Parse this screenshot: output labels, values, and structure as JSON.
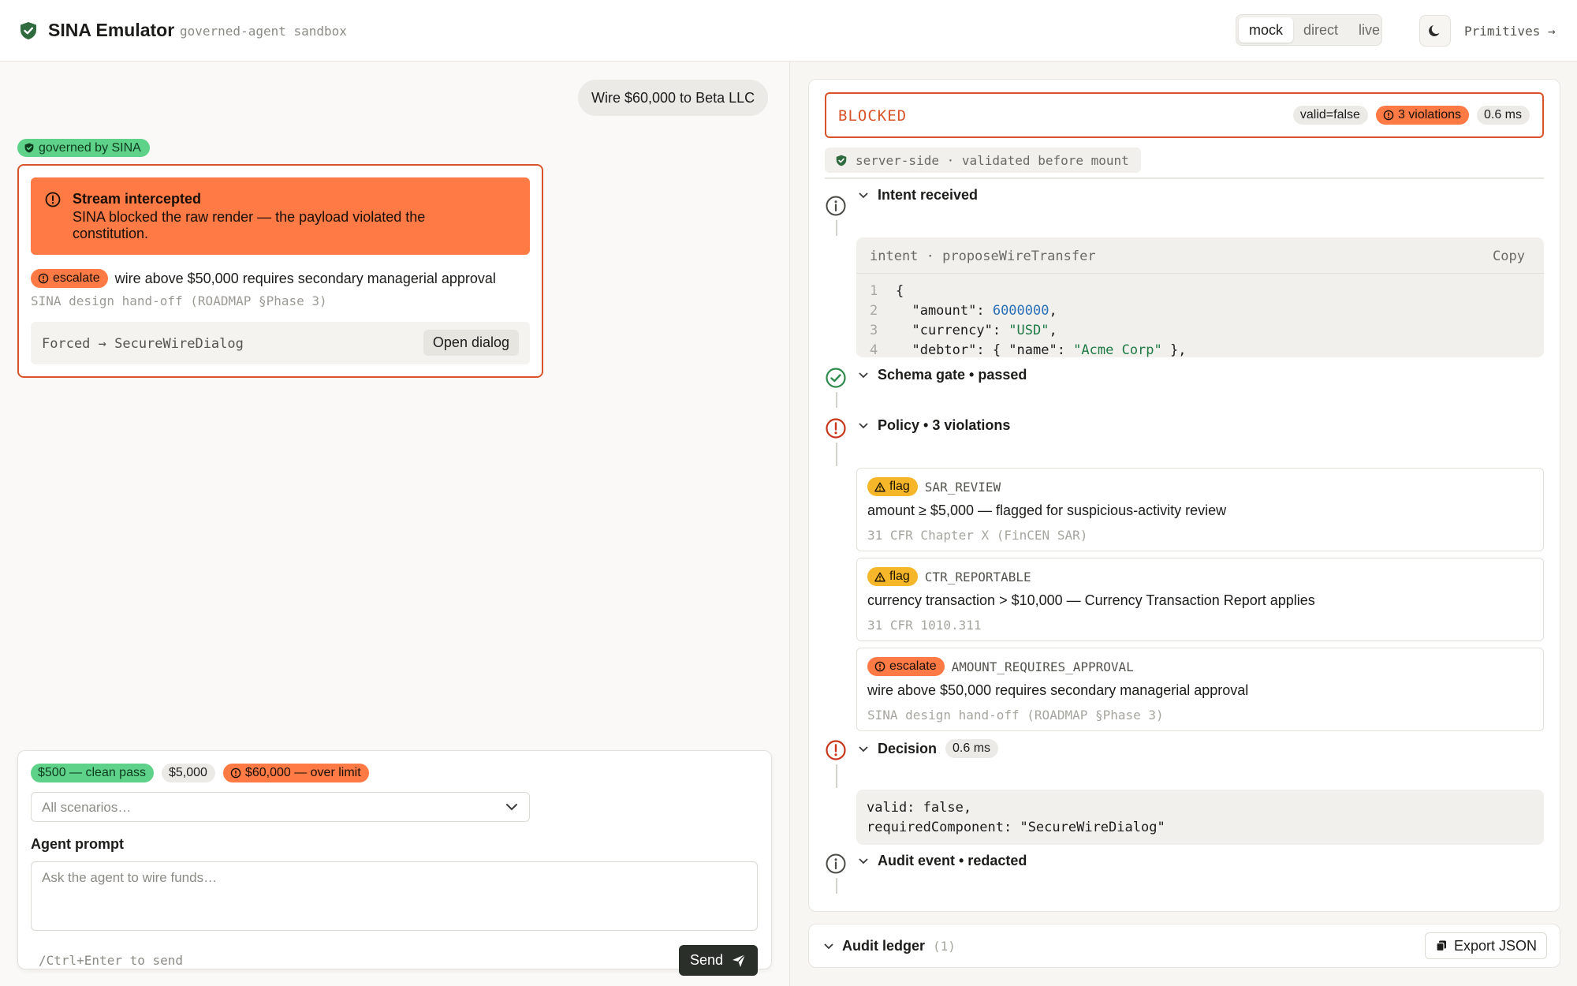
{
  "header": {
    "title": "SINA Emulator",
    "subtitle": "governed-agent sandbox",
    "modes": [
      "mock",
      "direct",
      "live"
    ],
    "active_mode": "mock",
    "primitives_link": "Primitives →"
  },
  "chat": {
    "user_message": "Wire $60,000 to Beta LLC",
    "governed_badge": "governed by SINA",
    "intercept": {
      "title": "Stream intercepted",
      "body": "SINA blocked the raw render — the payload violated the constitution.",
      "severity": "escalate",
      "rule_text": "wire above $50,000 requires secondary managerial approval",
      "reference": "SINA design hand-off (ROADMAP §Phase 3)",
      "forced_text": "Forced → SecureWireDialog",
      "open_dialog_label": "Open dialog"
    }
  },
  "composer": {
    "scenarios": [
      {
        "label": "$500 — clean pass",
        "tone": "green"
      },
      {
        "label": "$5,000",
        "tone": "gray"
      },
      {
        "label": "$60,000 — over limit",
        "tone": "orange"
      }
    ],
    "scenario_placeholder": "All scenarios…",
    "prompt_label": "Agent prompt",
    "prompt_placeholder": "Ask the agent to wire funds…",
    "hint": "/Ctrl+Enter to send",
    "send_label": "Send"
  },
  "inspector": {
    "status": "BLOCKED",
    "badges": {
      "valid": "valid=false",
      "violations": "3 violations",
      "latency": "0.6 ms"
    },
    "server_note": "server-side · validated before mount",
    "steps": {
      "intent": "Intent received",
      "schema": "Schema gate • passed",
      "policy": "Policy • 3 violations",
      "decision": "Decision",
      "decision_latency": "0.6 ms",
      "audit": "Audit event • redacted"
    },
    "intent_code": {
      "label": "intent · proposeWireTransfer",
      "copy_label": "Copy",
      "lines": [
        {
          "n": "1",
          "text": "{"
        },
        {
          "n": "2",
          "key": "  \"amount\": ",
          "value": "6000000",
          "tail": ","
        },
        {
          "n": "3",
          "key": "  \"currency\": ",
          "value": "\"USD\"",
          "tail": ","
        },
        {
          "n": "4",
          "key": "  \"debtor\": { \"name\": ",
          "value": "\"Acme Corp\"",
          "tail": " },"
        }
      ]
    },
    "violations": [
      {
        "severity": "flag",
        "code": "SAR_REVIEW",
        "description": "amount ≥ $5,000 — flagged for suspicious-activity review",
        "reference": "31 CFR Chapter X (FinCEN SAR)"
      },
      {
        "severity": "flag",
        "code": "CTR_REPORTABLE",
        "description": "currency transaction > $10,000 — Currency Transaction Report applies",
        "reference": "31 CFR 1010.311"
      },
      {
        "severity": "escalate",
        "code": "AMOUNT_REQUIRES_APPROVAL",
        "description": "wire above $50,000 requires secondary managerial approval",
        "reference": "SINA design hand-off (ROADMAP §Phase 3)"
      }
    ],
    "decision_code": {
      "line1": "valid: false,",
      "line2": "requiredComponent: \"SecureWireDialog\""
    }
  },
  "ledger": {
    "title": "Audit ledger",
    "count": "(1)",
    "export_label": "Export JSON"
  },
  "colors": {
    "accent_green": "#5fd28a",
    "escalate_orange": "#ff7a45",
    "blocked_red": "#d9532a",
    "flag_yellow": "#f5b62a"
  }
}
